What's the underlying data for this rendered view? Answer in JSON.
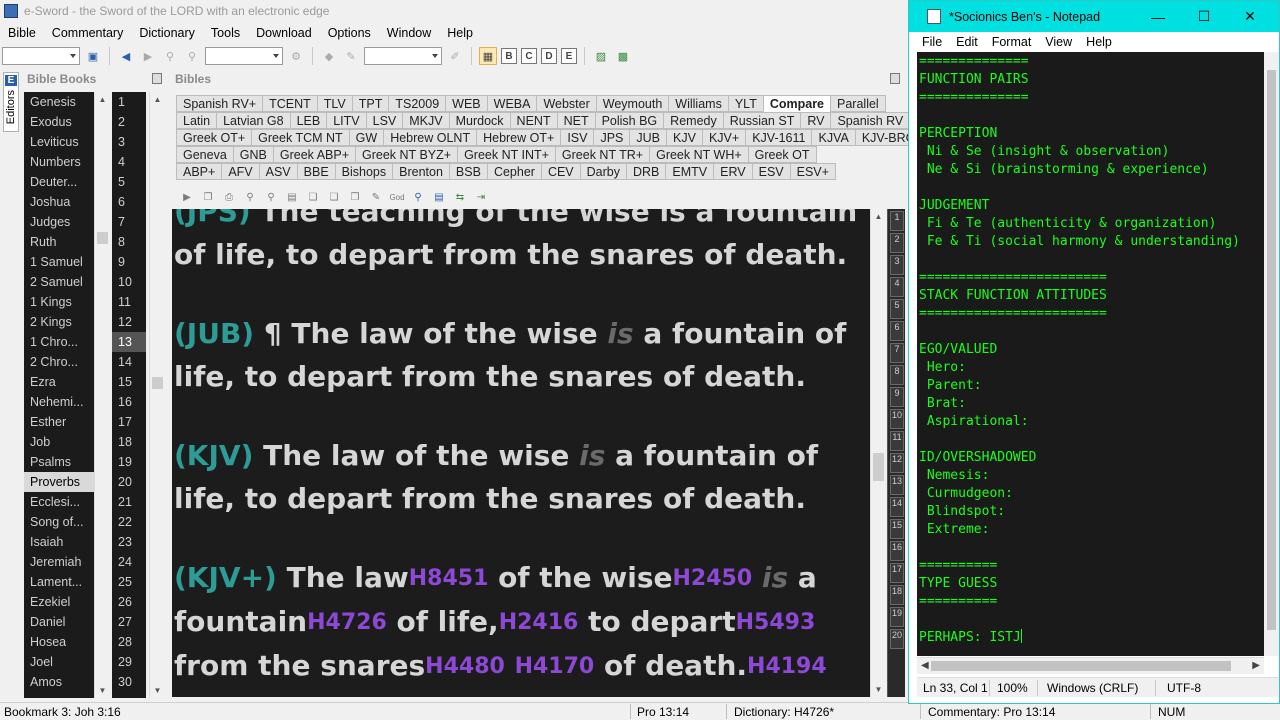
{
  "esword": {
    "title": "e-Sword - the Sword of the LORD with an electronic edge",
    "menu": [
      "Bible",
      "Commentary",
      "Dictionary",
      "Tools",
      "Download",
      "Options",
      "Window",
      "Help"
    ],
    "editors_tab": {
      "icon_letter": "E",
      "label": "Editors"
    },
    "bible_books_header": "Bible Books",
    "bibles_header": "Bibles",
    "books": [
      "Genesis",
      "Exodus",
      "Leviticus",
      "Numbers",
      "Deuter...",
      "Joshua",
      "Judges",
      "Ruth",
      "1 Samuel",
      "2 Samuel",
      "1 Kings",
      "2 Kings",
      "1 Chro...",
      "2 Chro...",
      "Ezra",
      "Nehemi...",
      "Esther",
      "Job",
      "Psalms",
      "Proverbs",
      "Ecclesi...",
      "Song of...",
      "Isaiah",
      "Jeremiah",
      "Lament...",
      "Ezekiel",
      "Daniel",
      "Hosea",
      "Joel",
      "Amos"
    ],
    "selected_book": "Proverbs",
    "chapters": [
      "1",
      "2",
      "3",
      "4",
      "5",
      "6",
      "7",
      "8",
      "9",
      "10",
      "11",
      "12",
      "13",
      "14",
      "15",
      "16",
      "17",
      "18",
      "19",
      "20",
      "21",
      "22",
      "23",
      "24",
      "25",
      "26",
      "27",
      "28",
      "29",
      "30"
    ],
    "selected_chapter": "13",
    "bible_tab_rows": [
      [
        "Spanish RV+",
        "TCENT",
        "TLV",
        "TPT",
        "TS2009",
        "WEB",
        "WEBA",
        "Webster",
        "Weymouth",
        "Williams",
        "YLT",
        "Compare",
        "Parallel"
      ],
      [
        "Latin",
        "Latvian G8",
        "LEB",
        "LITV",
        "LSV",
        "MKJV",
        "Murdock",
        "NENT",
        "NET",
        "Polish BG",
        "Remedy",
        "Russian ST",
        "RV",
        "Spanish RV"
      ],
      [
        "Greek OT+",
        "Greek TCM NT",
        "GW",
        "Hebrew OLNT",
        "Hebrew OT+",
        "ISV",
        "JPS",
        "JUB",
        "KJV",
        "KJV+",
        "KJV-1611",
        "KJVA",
        "KJV-BRG"
      ],
      [
        "Geneva",
        "GNB",
        "Greek ABP+",
        "Greek NT BYZ+",
        "Greek NT INT+",
        "Greek NT TR+",
        "Greek NT WH+",
        "Greek OT"
      ],
      [
        "ABP+",
        "AFV",
        "ASV",
        "BBE",
        "Bishops",
        "Brenton",
        "BSB",
        "Cepher",
        "CEV",
        "Darby",
        "DRB",
        "EMTV",
        "ERV",
        "ESV",
        "ESV+"
      ]
    ],
    "active_bible_tab": "Compare",
    "verses": {
      "jps": {
        "ref": "(JPS)",
        "text": "The teaching of the wise is a fountain of life, to depart from the snares of death."
      },
      "jub": {
        "ref": "(JUB)",
        "t1": "¶ The law of the wise ",
        "ital": "is",
        "t2": " a fountain of life, to depart from the snares of death."
      },
      "kjv": {
        "ref": "(KJV)",
        "t1": "The law of the wise ",
        "ital": "is",
        "t2": " a fountain of life, to depart from the snares of death."
      },
      "kjvplus": {
        "ref": "(KJV+)",
        "p1": "The law",
        "s1": "H8451",
        "p2": " of the wise",
        "s2": "H2450",
        "ital": "is",
        "p3": " a fountain",
        "s3": "H4726",
        "p4": " of life,",
        "s4": "H2416",
        "p5": " to depart",
        "s5": "H5493",
        "p6": " from the snares",
        "s6": "H4480",
        "s7": "H4170",
        "p7": " of death.",
        "s8": "H4194"
      }
    },
    "gutter_marks": [
      "1",
      "2",
      "3",
      "4",
      "5",
      "6",
      "7",
      "8",
      "9",
      "10",
      "11",
      "12",
      "13",
      "14",
      "15",
      "16",
      "17",
      "18",
      "19",
      "20"
    ],
    "status": {
      "bookmark": "Bookmark 3: Joh 3:16",
      "verse": "Pro 13:14",
      "dictionary": "Dictionary: H4726*",
      "commentary": "Commentary: Pro 13:14",
      "num": "NUM"
    }
  },
  "notepad": {
    "title": "*Socionics Ben's - Notepad",
    "menu": [
      "File",
      "Edit",
      "Format",
      "View",
      "Help"
    ],
    "lines": [
      "==============",
      "FUNCTION PAIRS",
      "==============",
      "",
      "PERCEPTION",
      " Ni & Se (insight & observation)",
      " Ne & Si (brainstorming & experience)",
      "",
      "JUDGEMENT",
      " Fi & Te (authenticity & organization)",
      " Fe & Ti (social harmony & understanding)",
      "",
      "========================",
      "STACK FUNCTION ATTITUDES",
      "========================",
      "",
      "EGO/VALUED",
      " Hero:",
      " Parent:",
      " Brat:",
      " Aspirational:",
      "",
      "ID/OVERSHADOWED",
      " Nemesis:",
      " Curmudgeon:",
      " Blindspot:",
      " Extreme:",
      "",
      "==========",
      "TYPE GUESS",
      "==========",
      "",
      "PERHAPS: ISTJ"
    ],
    "status": {
      "position": "Ln 33, Col 1",
      "zoom": "100%",
      "line_endings": "Windows (CRLF)",
      "encoding": "UTF-8"
    },
    "colors": {
      "titlebar": "#00e0e0",
      "text": "#1aff1a",
      "background": "#1a1a1a"
    }
  }
}
